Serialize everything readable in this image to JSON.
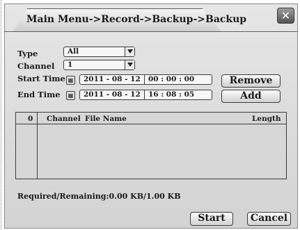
{
  "dialog": {
    "title": "Main Menu->Record->Backup->Backup",
    "close_icon": "close-icon"
  },
  "filters": {
    "type_label": "Type",
    "type_value": "All",
    "channel_label": "Channel",
    "channel_value": "1",
    "start_time_label": "Start Time",
    "start_date": "2011 - 08 - 12",
    "start_clock": "00 : 00 : 00",
    "end_time_label": "End Time",
    "end_date": "2011 - 08 - 12",
    "end_clock": "16 : 08 : 05",
    "calendar_icon": "calendar-icon"
  },
  "buttons": {
    "remove": "Remove",
    "add": "Add",
    "start": "Start",
    "cancel": "Cancel"
  },
  "table": {
    "headers": {
      "index": "0",
      "channel": "Channel",
      "file_name": "File Name",
      "length": "Length"
    },
    "rows": []
  },
  "status": {
    "required_remaining": "Required/Remaining:0.00 KB/1.00 KB"
  }
}
